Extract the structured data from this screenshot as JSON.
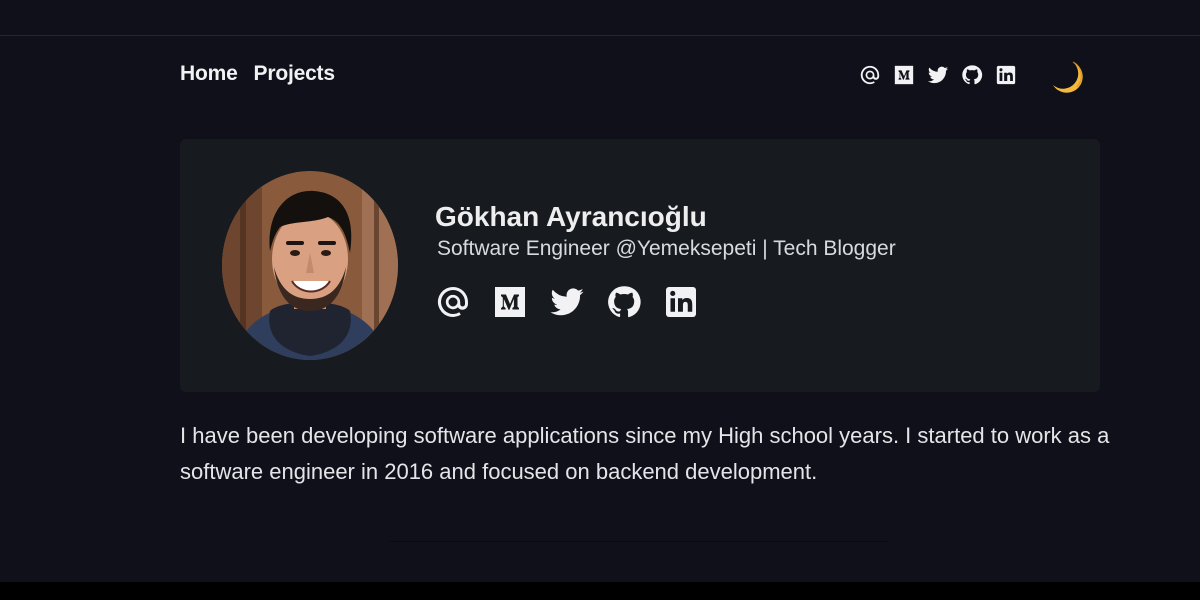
{
  "nav": {
    "links": [
      "Home",
      "Projects"
    ],
    "social_icons": [
      "at-icon",
      "medium-icon",
      "twitter-icon",
      "github-icon",
      "linkedin-icon"
    ],
    "theme_toggle_icon": "moon-icon"
  },
  "profile": {
    "name": "Gökhan Ayrancıoğlu",
    "tagline": "Software Engineer @Yemeksepeti | Tech Blogger",
    "social_icons": [
      "at-icon",
      "medium-icon",
      "twitter-icon",
      "github-icon",
      "linkedin-icon"
    ]
  },
  "bio": "I have been developing software applications since my High school years. I started to work as a software engineer in 2016 and focused on backend development.",
  "colors": {
    "background": "#0f1019",
    "card": "#171b1f",
    "text": "#e8e8ec",
    "moon": "#f4b93c"
  }
}
